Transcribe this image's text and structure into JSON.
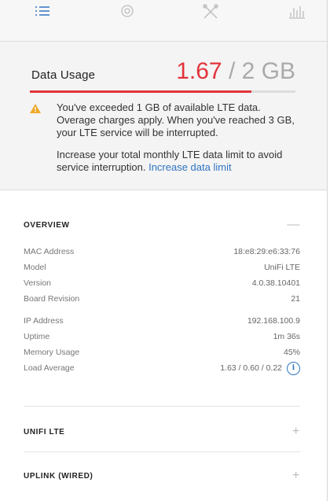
{
  "nav": {
    "tabs": [
      {
        "icon": "list-icon",
        "active": true
      },
      {
        "icon": "gear-icon",
        "active": false
      },
      {
        "icon": "tools-icon",
        "active": false
      },
      {
        "icon": "stats-icon",
        "active": false
      }
    ]
  },
  "usage": {
    "title": "Data Usage",
    "used": "1.67",
    "separator": " / ",
    "limit": "2 GB",
    "fraction_used": 0.835,
    "warning": "You've exceeded 1 GB of available LTE data. Overage charges apply. When you've reached 3 GB, your LTE service will be interrupted.",
    "limit_prompt": "Increase your total monthly LTE data limit to avoid service interruption.",
    "limit_link": "Increase data limit",
    "accent_color": "#e2343a",
    "link_color": "#2f74c0"
  },
  "overview": {
    "title": "OVERVIEW",
    "toggle": "—",
    "group1": [
      {
        "label": "MAC Address",
        "value": "18:e8:29:e6:33:76"
      },
      {
        "label": "Model",
        "value": "UniFi LTE"
      },
      {
        "label": "Version",
        "value": "4.0.38.10401"
      },
      {
        "label": "Board Revision",
        "value": "21"
      }
    ],
    "group2": [
      {
        "label": "IP Address",
        "value": "192.168.100.9"
      },
      {
        "label": "Uptime",
        "value": "1m 36s"
      },
      {
        "label": "Memory Usage",
        "value": "45%"
      },
      {
        "label": "Load Average",
        "value": "1.63 / 0.60 / 0.22",
        "icon": "info-icon"
      }
    ]
  },
  "sections": [
    {
      "title": "UNIFI LTE",
      "toggle": "+"
    },
    {
      "title": "UPLINK (WIRED)",
      "toggle": "+"
    }
  ]
}
